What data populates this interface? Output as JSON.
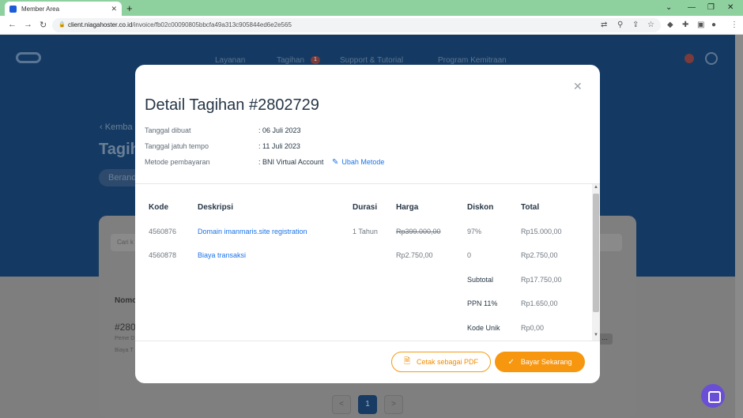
{
  "browser": {
    "tab_title": "Member Area",
    "url_host": "client.niagahoster.co.id",
    "url_path": "/invoice/fb02c00090805bbcfa49a313c905844ed6e2e565"
  },
  "background": {
    "nav": [
      "Layanan",
      "Tagihan",
      "Support & Tutorial",
      "Program Kemitraan"
    ],
    "nav_badge": "1",
    "back_link": "Kemba",
    "page_title": "Tagih",
    "pill": "Berand",
    "search_placeholder": "Cari k",
    "row_label": "Nomo",
    "row_number": "#280",
    "row_sub1": "Peme D",
    "row_sub2": "Biaya T",
    "more": "...",
    "page_current": "1",
    "page_prev": "<",
    "page_next": ">"
  },
  "modal": {
    "title": "Detail Tagihan #2802729",
    "created_label": "Tanggal dibuat",
    "created_value": ": 06 Juli 2023",
    "due_label": "Tanggal jatuh tempo",
    "due_value": ": 11 Juli 2023",
    "method_label": "Metode pembayaran",
    "method_value": ": BNI Virtual Account",
    "change_method": "Ubah Metode",
    "columns": [
      "Kode",
      "Deskripsi",
      "Durasi",
      "Harga",
      "Diskon",
      "Total"
    ],
    "rows": [
      {
        "kode": "4560876",
        "deskripsi": "Domain imanmaris.site registration",
        "durasi": "1 Tahun",
        "harga": "Rp399.000,00",
        "diskon": "97%",
        "total": "Rp15.000,00"
      },
      {
        "kode": "4560878",
        "deskripsi": "Biaya transaksi",
        "durasi": "",
        "harga": "Rp2.750,00",
        "diskon": "0",
        "total": "Rp2.750,00"
      }
    ],
    "summary": [
      {
        "label": "Subtotal",
        "value": "Rp17.750,00"
      },
      {
        "label": "PPN 11%",
        "value": "Rp1.650,00"
      },
      {
        "label": "Kode Unik",
        "value": "Rp0,00"
      }
    ],
    "btn_pdf": "Cetak sebagai PDF",
    "btn_pay": "Bayar Sekarang"
  },
  "colors": {
    "accent": "#f7960f",
    "link": "#1a73e8",
    "header_bg": "#143a63"
  }
}
